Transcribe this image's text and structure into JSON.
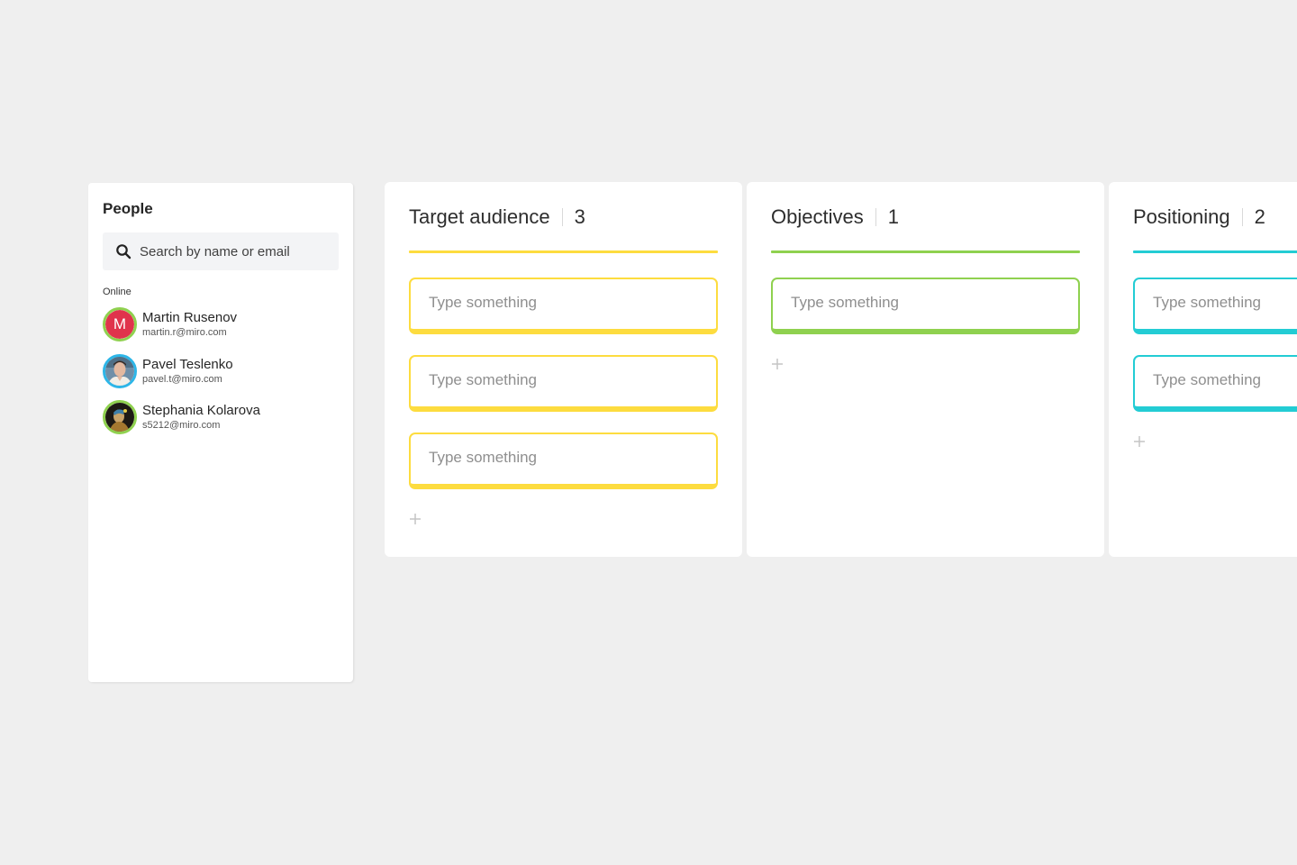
{
  "people_panel": {
    "title": "People",
    "search": {
      "placeholder": "Search by name or email",
      "value": "",
      "icon": "search-icon"
    },
    "section_label": "Online",
    "people": [
      {
        "name": "Martin Rusenov",
        "email": "martin.r@miro.com",
        "avatar": "initial",
        "initial": "M",
        "avatar_color": "#e0334c",
        "ring_color": "#8fd14f"
      },
      {
        "name": "Pavel Teslenko",
        "email": "pavel.t@miro.com",
        "avatar": "photo",
        "ring_color": "#2db6e8"
      },
      {
        "name": "Stephania Kolarova",
        "email": "s5212@miro.com",
        "avatar": "photo",
        "ring_color": "#8fd14f"
      }
    ]
  },
  "columns": [
    {
      "title": "Target audience",
      "count": "3",
      "accent": "#fddc3f",
      "cards": [
        {
          "placeholder": "Type something",
          "value": ""
        },
        {
          "placeholder": "Type something",
          "value": ""
        },
        {
          "placeholder": "Type something",
          "value": ""
        }
      ],
      "add_icon": "plus-icon"
    },
    {
      "title": "Objectives",
      "count": "1",
      "accent": "#8fd14f",
      "cards": [
        {
          "placeholder": "Type something",
          "value": ""
        }
      ],
      "add_icon": "plus-icon"
    },
    {
      "title": "Positioning",
      "count": "2",
      "accent": "#23ccd4",
      "cards": [
        {
          "placeholder": "Type something",
          "value": ""
        },
        {
          "placeholder": "Type something",
          "value": ""
        }
      ],
      "add_icon": "plus-icon"
    }
  ]
}
